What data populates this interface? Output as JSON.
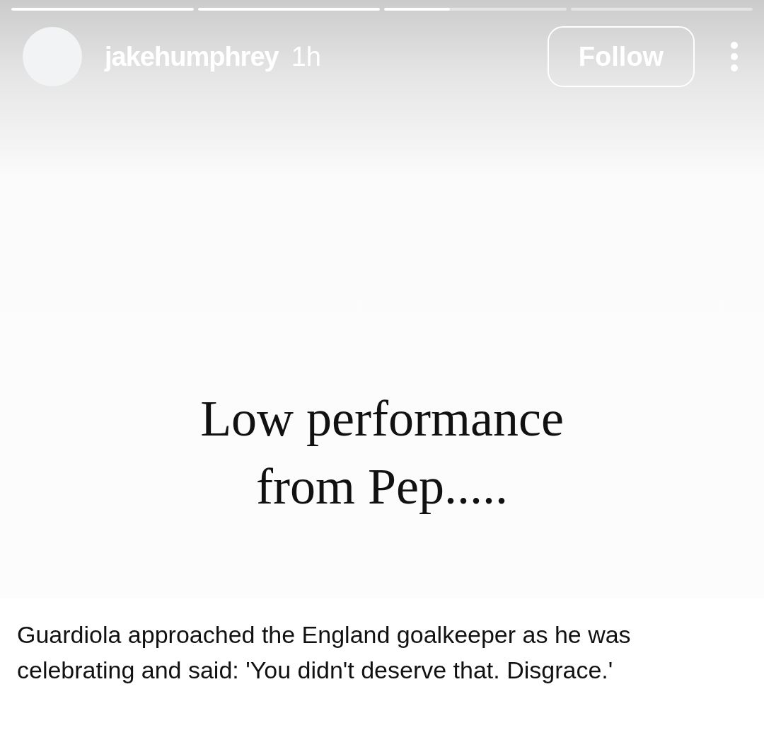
{
  "progress": [
    {
      "level": 1
    },
    {
      "level": 1
    },
    {
      "level": 0.36
    },
    {
      "level": 0
    }
  ],
  "header": {
    "username": "jakehumphrey",
    "time": "1h",
    "follow_button": "Follow"
  },
  "post": {
    "headline": [
      "Low performance",
      "from Pep....."
    ],
    "caption": "Guardiola approached the England goalkeeper as he was celebrating and said: 'You didn't deserve that. Disgrace.'"
  }
}
